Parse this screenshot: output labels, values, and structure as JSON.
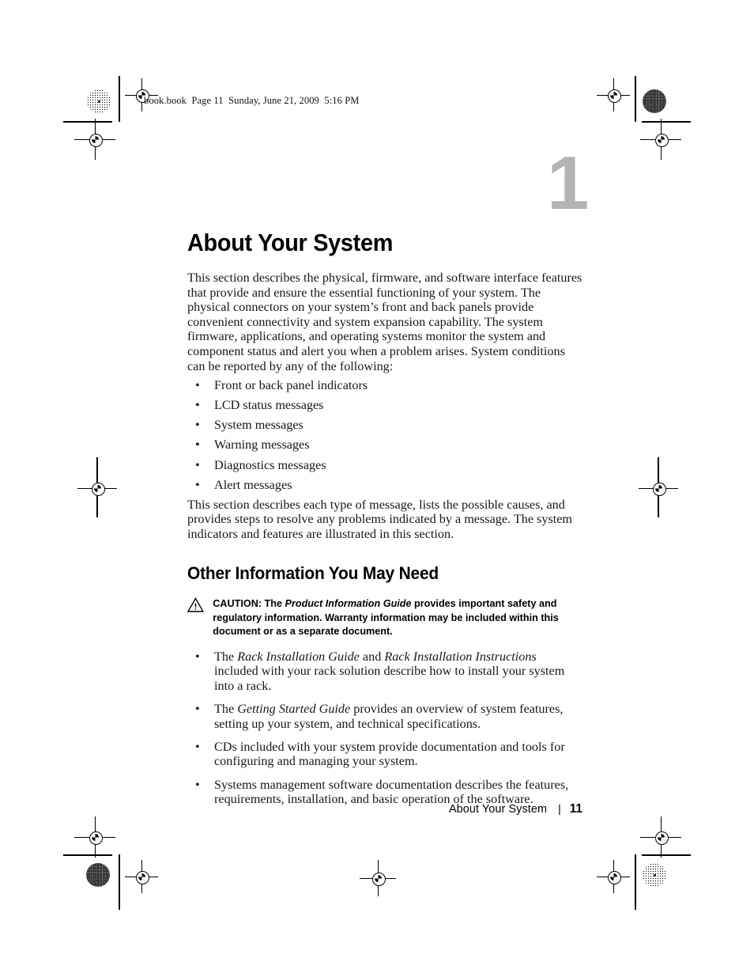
{
  "running_header": "book.book  Page 11  Sunday, June 21, 2009  5:16 PM",
  "chapter": {
    "number": "1",
    "title": "About Your System",
    "number_color": "#b4b4b4"
  },
  "intro_paragraph": "This section describes the physical, firmware, and software interface features that provide and ensure the essential functioning of your system. The physical connectors on your system’s front and back panels provide convenient connectivity and system expansion capability. The system firmware, applications, and operating systems monitor the system and component status and alert you when a problem arises. System conditions can be reported by any of the following:",
  "condition_bullets": [
    "Front or back panel indicators",
    "LCD status messages",
    "System messages",
    "Warning messages",
    "Diagnostics messages",
    "Alert messages"
  ],
  "closing_paragraph": "This section describes each type of message, lists the possible causes, and provides steps to resolve any problems indicated by a message. The system indicators and features are illustrated in this section.",
  "section": {
    "heading": "Other Information You May Need"
  },
  "caution": {
    "icon": "warning-triangle-icon",
    "label": "CAUTION:",
    "text_before": " The ",
    "guide_title": "Product Information Guide",
    "text_after": " provides important safety and regulatory information. Warranty information may be included within this document or as a separate document."
  },
  "resource_bullets": [
    {
      "pre": "The ",
      "italic1": "Rack Installation Guide",
      "mid": " and ",
      "italic2": "Rack Installation Instructions",
      "post": " included with your rack solution describe how to install your system into a rack."
    },
    {
      "pre": "The ",
      "italic1": "Getting Started Guide",
      "mid": "",
      "italic2": "",
      "post": " provides an overview of system features, setting up your system, and technical specifications."
    },
    {
      "pre": "CDs included with your system provide documentation and tools for configuring and managing your system.",
      "italic1": "",
      "mid": "",
      "italic2": "",
      "post": ""
    },
    {
      "pre": "Systems management software documentation describes the features, requirements, installation, and basic operation of the software.",
      "italic1": "",
      "mid": "",
      "italic2": "",
      "post": ""
    }
  ],
  "bullet_glyph": "•",
  "footer": {
    "title": "About Your System",
    "separator": "|",
    "page_number": "11"
  }
}
